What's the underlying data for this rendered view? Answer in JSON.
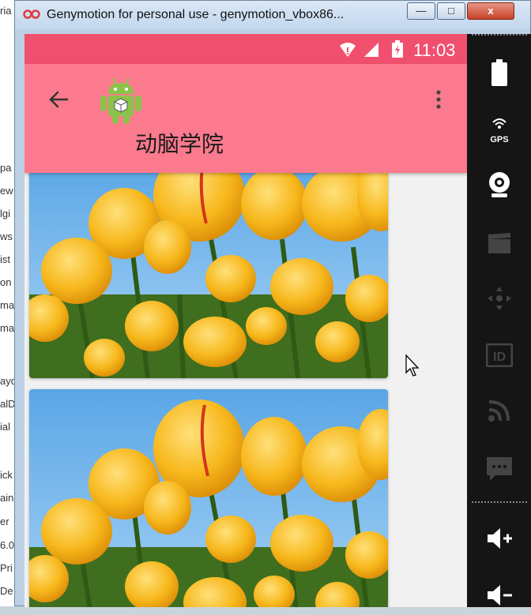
{
  "window": {
    "title": "Genymotion for personal use - genymotion_vbox86...",
    "min_glyph": "—",
    "max_glyph": "□",
    "close_glyph": "x"
  },
  "background_app": {
    "fragments": [
      "ria",
      "pa",
      "ew",
      "lgi",
      "ws",
      "ist",
      "on",
      "ma",
      "ma",
      "ayd",
      "alD",
      "ial",
      "ick",
      "ain",
      "er",
      "6.0",
      "Pri",
      "De"
    ]
  },
  "device": {
    "status_bar": {
      "time": "11:03"
    },
    "app_bar": {
      "title": "动脑学院"
    },
    "cards": [
      {
        "image": "tulips-photo"
      },
      {
        "image": "tulips-photo"
      }
    ],
    "toolbar": {
      "gps_label": "GPS",
      "id_label": "ID"
    }
  },
  "colors": {
    "status_bar": "#f0506e",
    "app_bar": "#fb7a8e",
    "sidebar": "#151515"
  }
}
